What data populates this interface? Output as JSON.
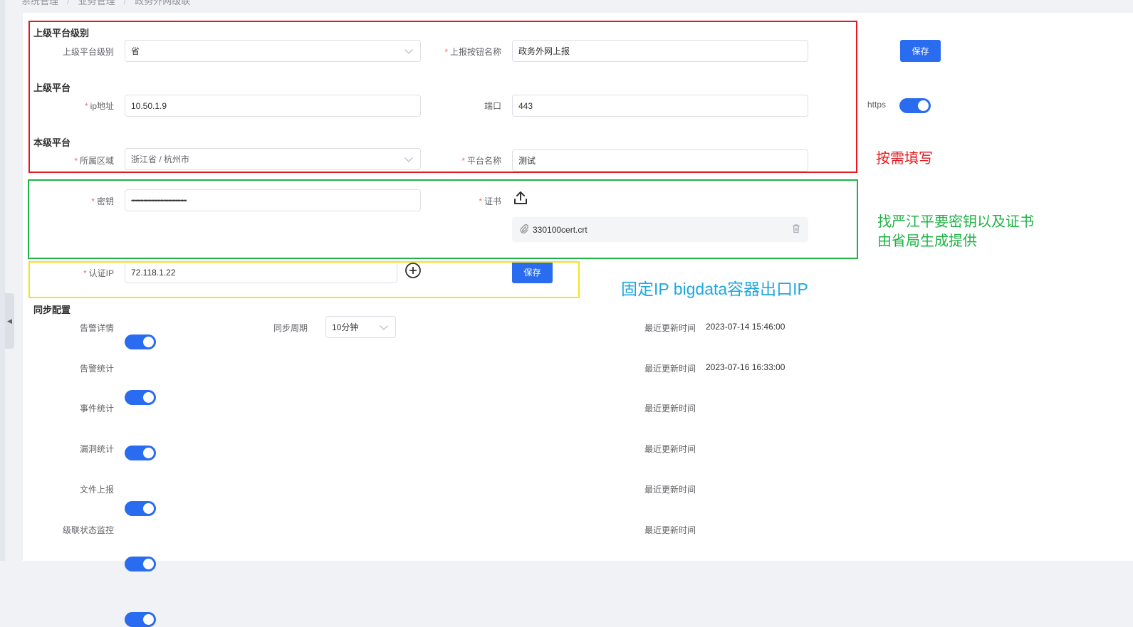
{
  "breadcrumb": {
    "items": [
      "系统管理",
      "业务管理",
      "政务外网级联"
    ]
  },
  "upper_level": {
    "section_title": "上级平台级别",
    "level_label": "上级平台级别",
    "level_value": "省",
    "button_name_label": "上报按钮名称",
    "button_name_value": "政务外网上报",
    "save_label": "保存"
  },
  "upper_platform": {
    "section_title": "上级平台",
    "ip_label": "ip地址",
    "ip_value": "10.50.1.9",
    "port_label": "端口",
    "port_value": "443",
    "https_label": "https",
    "https_enabled": true
  },
  "local_platform": {
    "section_title": "本级平台",
    "region_label": "所属区域",
    "region_value": "浙江省 / 杭州市",
    "name_label": "平台名称",
    "name_value": "测试"
  },
  "security": {
    "key_label": "密钥",
    "key_value": "••••••••••••••••••••••••••••••••••••",
    "cert_label": "证书",
    "cert_file": "330100cert.crt"
  },
  "auth_ip": {
    "label": "认证IP",
    "value": "72.118.1.22",
    "save_label": "保存"
  },
  "sync": {
    "section_title": "同步配置",
    "period_label": "同步周期",
    "period_value": "10分钟",
    "time_label": "最近更新时间",
    "items": [
      {
        "label": "告警详情",
        "enabled": true,
        "time": "2023-07-14 15:46:00"
      },
      {
        "label": "告警统计",
        "enabled": true,
        "time": "2023-07-16 16:33:00"
      },
      {
        "label": "事件统计",
        "enabled": true,
        "time": ""
      },
      {
        "label": "漏洞统计",
        "enabled": true,
        "time": ""
      },
      {
        "label": "文件上报",
        "enabled": true,
        "time": ""
      },
      {
        "label": "级联状态监控",
        "enabled": true,
        "time": ""
      }
    ]
  },
  "annotations": {
    "red_note": "按需填写",
    "green_note_line1": "找严江平要密钥以及证书",
    "green_note_line2": "由省局生成提供",
    "yellow_note": "固定IP bigdata容器出口IP"
  },
  "colors": {
    "primary": "#2a6cf0",
    "required": "#f56c6c",
    "annotation_red": "#e5191f",
    "annotation_green": "#1fb345",
    "annotation_yellow": "#f2e51a",
    "annotation_blue": "#1ea7e0"
  }
}
